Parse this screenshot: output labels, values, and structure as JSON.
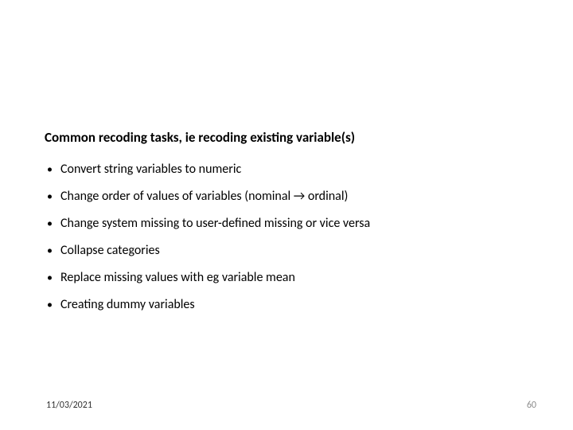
{
  "heading": "Common recoding tasks, ie recoding existing variable(s)",
  "bullets": [
    "Convert string variables to numeric",
    "Change order of values of variables (nominal → ordinal)",
    "Change system missing to user-defined missing or vice versa",
    "Collapse categories",
    "Replace missing values with eg variable mean",
    "Creating dummy variables"
  ],
  "footer": {
    "date": "11/03/2021",
    "page": "60"
  }
}
